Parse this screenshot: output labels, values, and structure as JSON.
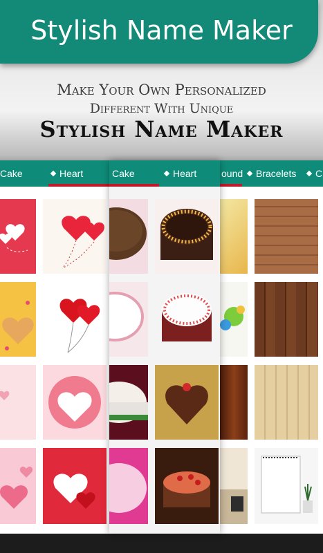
{
  "header": {
    "title": "Stylish Name Maker"
  },
  "promo": {
    "line1": "Make Your Own Personalized",
    "line2": "Different With Unique",
    "line3": "Stylish Name Maker"
  },
  "panels": {
    "left": {
      "tabs": [
        "Cake",
        "Heart"
      ]
    },
    "mid": {
      "tabs": [
        "Cake",
        "Heart"
      ]
    },
    "right": {
      "tabs": [
        "ound",
        "Bracelets",
        "C"
      ]
    }
  },
  "colors": {
    "header": "#138a78",
    "tabbar": "#0f8c79",
    "underline": "#c01929"
  }
}
